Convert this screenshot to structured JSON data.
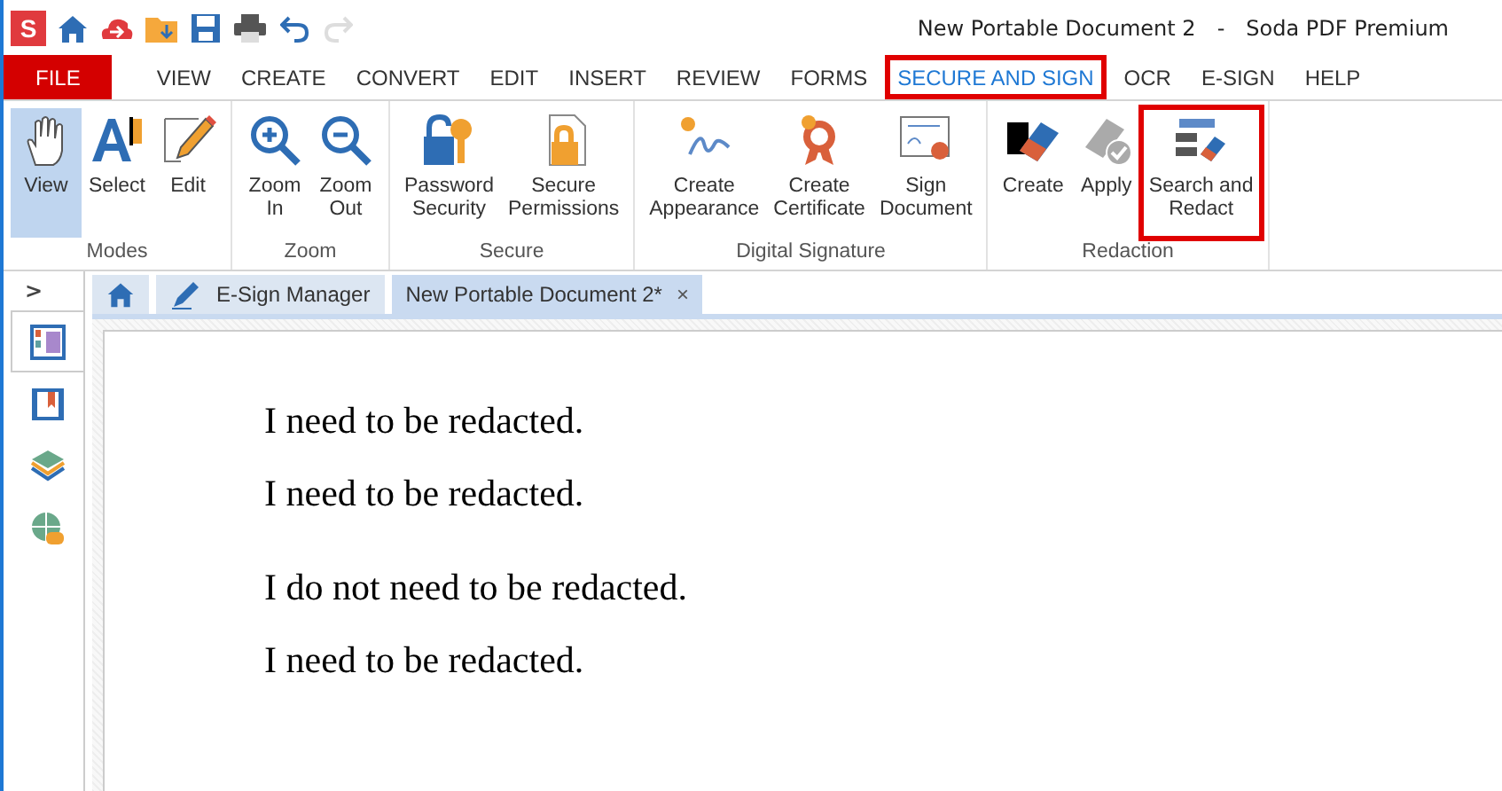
{
  "title_bar": {
    "document": "New Portable Document 2",
    "separator": "-",
    "app": "Soda PDF Premium"
  },
  "logo": "S",
  "quick_access": [
    {
      "kind": "home",
      "disabled": false
    },
    {
      "kind": "cloud",
      "disabled": false
    },
    {
      "kind": "folder",
      "disabled": false
    },
    {
      "kind": "save",
      "disabled": false
    },
    {
      "kind": "print",
      "disabled": false
    },
    {
      "kind": "undo",
      "disabled": false
    },
    {
      "kind": "redo",
      "disabled": true
    }
  ],
  "file_menu": "FILE",
  "menu": [
    {
      "label": "VIEW",
      "selected": false,
      "highlighted": false
    },
    {
      "label": "CREATE",
      "selected": false,
      "highlighted": false
    },
    {
      "label": "CONVERT",
      "selected": false,
      "highlighted": false
    },
    {
      "label": "EDIT",
      "selected": false,
      "highlighted": false
    },
    {
      "label": "INSERT",
      "selected": false,
      "highlighted": false
    },
    {
      "label": "REVIEW",
      "selected": false,
      "highlighted": false
    },
    {
      "label": "FORMS",
      "selected": false,
      "highlighted": false
    },
    {
      "label": "SECURE AND SIGN",
      "selected": true,
      "highlighted": true
    },
    {
      "label": "OCR",
      "selected": false,
      "highlighted": false
    },
    {
      "label": "E-SIGN",
      "selected": false,
      "highlighted": false
    },
    {
      "label": "HELP",
      "selected": false,
      "highlighted": false
    }
  ],
  "ribbon": [
    {
      "label": "Modes",
      "buttons": [
        {
          "label": "View",
          "active": true,
          "highlighted": false
        },
        {
          "label": "Select",
          "active": false,
          "highlighted": false
        },
        {
          "label": "Edit",
          "active": false,
          "highlighted": false
        }
      ]
    },
    {
      "label": "Zoom",
      "buttons": [
        {
          "label": "Zoom\nIn",
          "active": false,
          "highlighted": false
        },
        {
          "label": "Zoom\nOut",
          "active": false,
          "highlighted": false
        }
      ]
    },
    {
      "label": "Secure",
      "buttons": [
        {
          "label": "Password\nSecurity",
          "active": false,
          "highlighted": false
        },
        {
          "label": "Secure\nPermissions",
          "active": false,
          "highlighted": false
        }
      ]
    },
    {
      "label": "Digital Signature",
      "buttons": [
        {
          "label": "Create\nAppearance",
          "active": false,
          "highlighted": false
        },
        {
          "label": "Create\nCertificate",
          "active": false,
          "highlighted": false
        },
        {
          "label": "Sign\nDocument",
          "active": false,
          "highlighted": false
        }
      ]
    },
    {
      "label": "Redaction",
      "buttons": [
        {
          "label": "Create",
          "active": false,
          "highlighted": false
        },
        {
          "label": "Apply",
          "active": false,
          "highlighted": false
        },
        {
          "label": "Search and\nRedact",
          "active": false,
          "highlighted": true
        }
      ]
    }
  ],
  "side_panel": {
    "toggle": ">",
    "items": [
      {
        "kind": "pages",
        "selected": true
      },
      {
        "kind": "bookmarks",
        "selected": false
      },
      {
        "kind": "layers",
        "selected": false
      },
      {
        "kind": "links",
        "selected": false
      }
    ]
  },
  "doc_tabs": [
    {
      "kind": "home",
      "selected": false
    },
    {
      "kind": "esign",
      "label": "E-Sign Manager",
      "selected": false
    },
    {
      "kind": "document",
      "label": "New Portable Document 2*",
      "selected": true,
      "close": "×"
    }
  ],
  "document": {
    "lines": [
      "I need to be redacted.",
      "I need to be redacted.",
      "I do not need to be redacted.",
      "I need to be redacted."
    ]
  }
}
